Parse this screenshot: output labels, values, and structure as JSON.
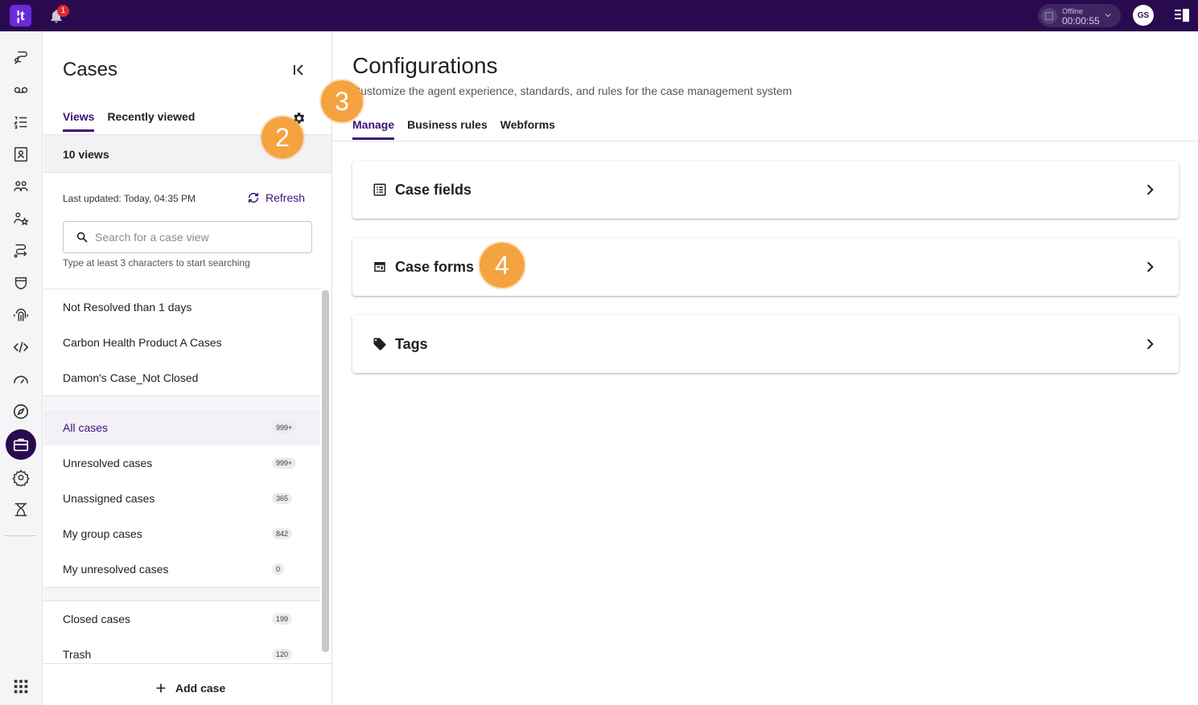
{
  "topbar": {
    "logo_text": "¦t",
    "notification_count": "1",
    "agent_status": "Offline",
    "agent_timer": "00:00:55",
    "avatar_initials": "GS"
  },
  "rail": {
    "items": [
      "conversations-icon",
      "voicemail-icon",
      "task-list-icon",
      "contacts-icon",
      "team-icon",
      "skills-icon",
      "routing-icon",
      "security-icon",
      "fingerprint-icon",
      "developer-icon",
      "dashboard-icon",
      "explore-icon",
      "cases-icon",
      "settings-icon",
      "workflow-icon"
    ],
    "active": "cases-icon"
  },
  "cases_panel": {
    "title": "Cases",
    "tabs": [
      {
        "label": "Views",
        "active": true
      },
      {
        "label": "Recently viewed",
        "active": false
      }
    ],
    "views_count": "10 views",
    "last_updated_label": "Last updated:",
    "last_updated_value": "Today, 04:35 PM",
    "refresh_label": "Refresh",
    "search": {
      "placeholder": "Search for a case view",
      "value": "",
      "hint": "Type at least 3 characters to start searching"
    },
    "custom_views": [
      {
        "label": "Not Resolved than 1 days"
      },
      {
        "label": "Carbon Health Product A Cases"
      },
      {
        "label": "Damon's Case_Not Closed"
      }
    ],
    "standard_views": [
      {
        "label": "All cases",
        "count": "999+",
        "selected": true
      },
      {
        "label": "Unresolved cases",
        "count": "999+"
      },
      {
        "label": "Unassigned cases",
        "count": "365"
      },
      {
        "label": "My group cases",
        "count": "842"
      },
      {
        "label": "My unresolved cases",
        "count": "0"
      }
    ],
    "other_views": [
      {
        "label": "Closed cases",
        "count": "199"
      },
      {
        "label": "Trash",
        "count": "120"
      }
    ],
    "add_case_label": "Add case"
  },
  "main": {
    "title": "Configurations",
    "subtitle": "Customize the agent experience, standards, and rules for the case management system",
    "tabs": [
      {
        "label": "Manage",
        "active": true
      },
      {
        "label": "Business rules",
        "active": false
      },
      {
        "label": "Webforms",
        "active": false
      }
    ],
    "cards": [
      {
        "label": "Case fields",
        "icon": "list-icon"
      },
      {
        "label": "Case forms",
        "icon": "form-icon"
      },
      {
        "label": "Tags",
        "icon": "tag-icon"
      }
    ]
  },
  "step_markers": [
    "2",
    "3",
    "4"
  ],
  "colors": {
    "topbar": "#2a0a4e",
    "accent": "#3b137a",
    "step_marker": "#f5a340",
    "badge_red": "#e0262f"
  }
}
